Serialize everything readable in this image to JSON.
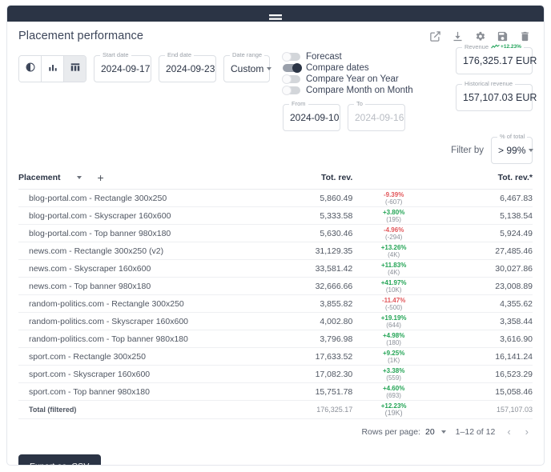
{
  "window": {
    "drag_handle_icon": "drag-handle-icon"
  },
  "header": {
    "title": "Placement performance",
    "tools": [
      {
        "name": "open-in-new-icon",
        "label": "Open in new window"
      },
      {
        "name": "download-icon",
        "label": "Download"
      },
      {
        "name": "gear-icon",
        "label": "Settings"
      },
      {
        "name": "save-icon",
        "label": "Save"
      },
      {
        "name": "trash-icon",
        "label": "Delete"
      }
    ]
  },
  "view_toggle": {
    "options": [
      {
        "name": "pie-chart-view",
        "icon": "pie-chart-icon",
        "active": false
      },
      {
        "name": "bar-chart-view",
        "icon": "bar-chart-icon",
        "active": false
      },
      {
        "name": "table-view",
        "icon": "table-icon",
        "active": true
      }
    ]
  },
  "filters": {
    "start_date": {
      "legend": "Start date",
      "value": "2024-09-17"
    },
    "end_date": {
      "legend": "End date",
      "value": "2024-09-23"
    },
    "date_range": {
      "legend": "Date range",
      "value": "Custom"
    },
    "from": {
      "legend": "From",
      "value": "2024-09-10"
    },
    "to": {
      "legend": "To",
      "value": "2024-09-16",
      "is_placeholder": true
    }
  },
  "toggles": [
    {
      "label": "Forecast",
      "on": false
    },
    {
      "label": "Compare dates",
      "on": true
    },
    {
      "label": "Compare Year on Year",
      "on": false
    },
    {
      "label": "Compare Month on Month",
      "on": false
    }
  ],
  "kpis": {
    "revenue": {
      "legend": "Revenue",
      "trend": "+12.23%",
      "value": "176,325.17 EUR"
    },
    "historical_revenue": {
      "legend": "Historical revenue",
      "value": "157,107.03 EUR"
    }
  },
  "filter_by": {
    "label": "Filter by",
    "legend": "% of total",
    "value": "> 99%"
  },
  "table": {
    "columns": [
      {
        "key": "placement",
        "label": "Placement"
      },
      {
        "key": "tot_rev",
        "label": "Tot. rev."
      },
      {
        "key": "delta",
        "label": ""
      },
      {
        "key": "tot_rev_hist",
        "label": "Tot. rev.*"
      }
    ],
    "rows": [
      {
        "placement": "blog-portal.com - Rectangle 300x250",
        "tot_rev": "5,860.49",
        "delta_pct": "-9.39%",
        "delta_abs": "(-607)",
        "dir": "down",
        "tot_rev_hist": "6,467.83"
      },
      {
        "placement": "blog-portal.com - Skyscraper 160x600",
        "tot_rev": "5,333.58",
        "delta_pct": "+3.80%",
        "delta_abs": "(195)",
        "dir": "up",
        "tot_rev_hist": "5,138.54"
      },
      {
        "placement": "blog-portal.com - Top banner 980x180",
        "tot_rev": "5,630.46",
        "delta_pct": "-4.96%",
        "delta_abs": "(-294)",
        "dir": "down",
        "tot_rev_hist": "5,924.49"
      },
      {
        "placement": "news.com - Rectangle 300x250 (v2)",
        "tot_rev": "31,129.35",
        "delta_pct": "+13.26%",
        "delta_abs": "(4K)",
        "dir": "up",
        "tot_rev_hist": "27,485.46"
      },
      {
        "placement": "news.com - Skyscraper 160x600",
        "tot_rev": "33,581.42",
        "delta_pct": "+11.83%",
        "delta_abs": "(4K)",
        "dir": "up",
        "tot_rev_hist": "30,027.86"
      },
      {
        "placement": "news.com - Top banner 980x180",
        "tot_rev": "32,666.66",
        "delta_pct": "+41.97%",
        "delta_abs": "(10K)",
        "dir": "up",
        "tot_rev_hist": "23,008.89"
      },
      {
        "placement": "random-politics.com - Rectangle 300x250",
        "tot_rev": "3,855.82",
        "delta_pct": "-11.47%",
        "delta_abs": "(-500)",
        "dir": "down",
        "tot_rev_hist": "4,355.62"
      },
      {
        "placement": "random-politics.com - Skyscraper 160x600",
        "tot_rev": "4,002.80",
        "delta_pct": "+19.19%",
        "delta_abs": "(644)",
        "dir": "up",
        "tot_rev_hist": "3,358.44"
      },
      {
        "placement": "random-politics.com - Top banner 980x180",
        "tot_rev": "3,796.98",
        "delta_pct": "+4.98%",
        "delta_abs": "(180)",
        "dir": "up",
        "tot_rev_hist": "3,616.90"
      },
      {
        "placement": "sport.com - Rectangle 300x250",
        "tot_rev": "17,633.52",
        "delta_pct": "+9.25%",
        "delta_abs": "(1K)",
        "dir": "up",
        "tot_rev_hist": "16,141.24"
      },
      {
        "placement": "sport.com - Skyscraper 160x600",
        "tot_rev": "17,082.30",
        "delta_pct": "+3.38%",
        "delta_abs": "(559)",
        "dir": "up",
        "tot_rev_hist": "16,523.29"
      },
      {
        "placement": "sport.com - Top banner 980x180",
        "tot_rev": "15,751.78",
        "delta_pct": "+4.60%",
        "delta_abs": "(693)",
        "dir": "up",
        "tot_rev_hist": "15,058.46"
      }
    ],
    "total_row": {
      "placement": "Total (filtered)",
      "tot_rev": "176,325.17",
      "delta_pct": "+12.23%",
      "delta_abs": "(19K)",
      "dir": "up",
      "tot_rev_hist": "157,107.03"
    }
  },
  "pagination": {
    "rows_per_page_label": "Rows per page:",
    "rows_per_page_value": "20",
    "range_label": "1–12 of 12",
    "prev_icon": "chevron-left-icon",
    "next_icon": "chevron-right-icon"
  },
  "export": {
    "label": "Export as .CSV"
  },
  "colors": {
    "accent_dark": "#2b3445",
    "positive": "#23a455",
    "negative": "#e2575b",
    "border": "#dcdfe4"
  }
}
